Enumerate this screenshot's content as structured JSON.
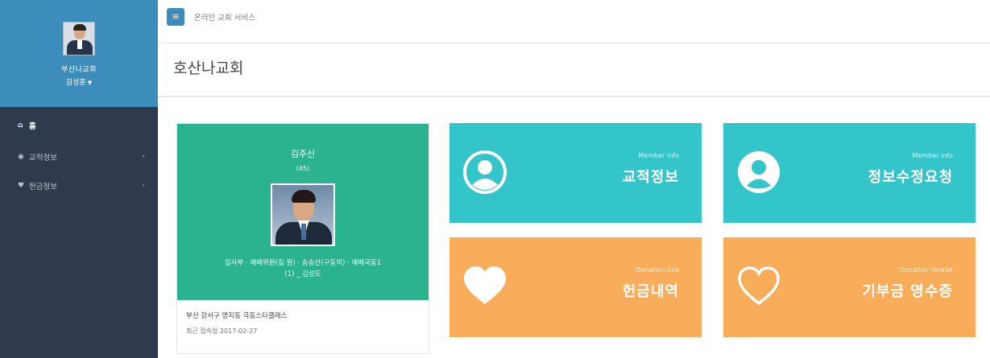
{
  "sidebar": {
    "user": {
      "church": "부산나교회",
      "name": "김성훈"
    },
    "menu": [
      {
        "label": "홈",
        "icon": "home-icon"
      },
      {
        "label": "교적정보",
        "icon": "user-circle-icon"
      },
      {
        "label": "헌금정보",
        "icon": "heart-icon"
      }
    ]
  },
  "header": {
    "title": "온라인 교회 서비스"
  },
  "page": {
    "title": "호산나교회"
  },
  "profile": {
    "name": "김주신",
    "role": "(45)",
    "detail_line1": "집사부 · 예배위원(집 원) · 송송산(구동의) · 예배국동1",
    "detail_line2": "(1) _ 김성도",
    "address": "부산 강서구 명지동 극동스타클래스",
    "last_login": "최근 접속일 2017-02-27"
  },
  "tiles": [
    {
      "sub": "Member info",
      "main": "교적정보",
      "icon": "user-circle-icon",
      "color": "#33c5c9"
    },
    {
      "sub": "Member info",
      "main": "정보수정요청",
      "icon": "user-circle-icon",
      "color": "#33c5c9"
    },
    {
      "sub": "Donation info",
      "main": "헌금내역",
      "icon": "heart-icon",
      "color": "#f9ac5a"
    },
    {
      "sub": "Donation receipt",
      "main": "기부금 영수증",
      "icon": "heart-outline-icon",
      "color": "#f9ac5a"
    }
  ]
}
